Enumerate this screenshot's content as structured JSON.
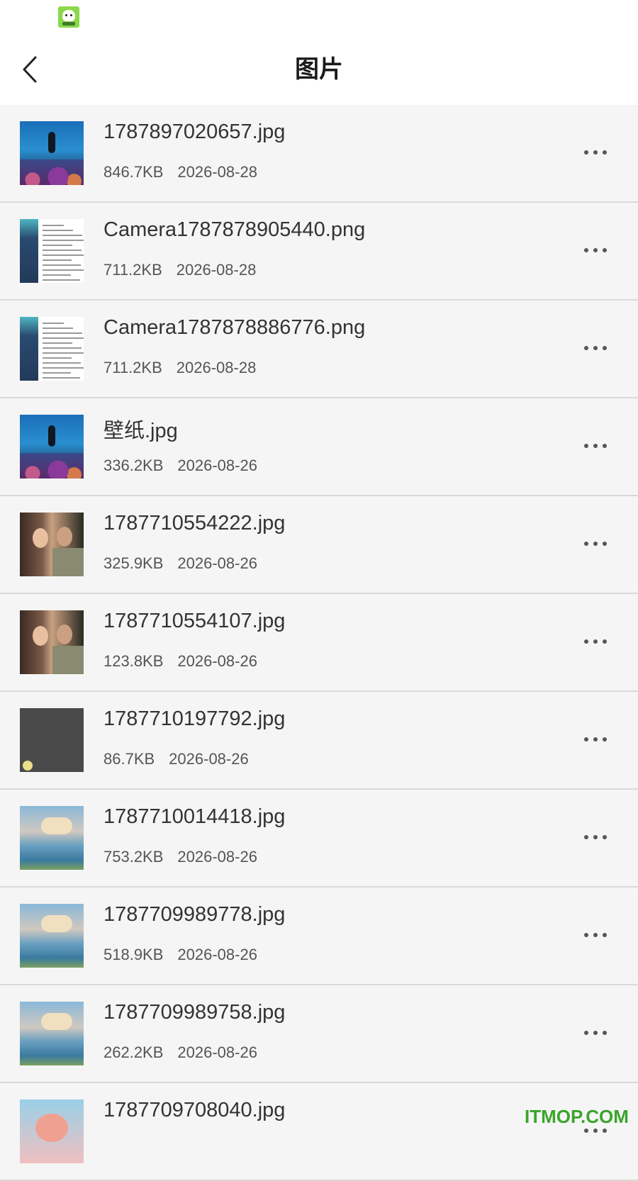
{
  "header": {
    "title": "图片",
    "back_icon": "chevron-left-icon"
  },
  "status_bar": {
    "app_icon": "app-notification-icon"
  },
  "files": [
    {
      "name": "1787897020657.jpg",
      "size": "846.7KB",
      "date": "2026-08-28",
      "thumb": "ocean"
    },
    {
      "name": "Camera1787878905440.png",
      "size": "711.2KB",
      "date": "2026-08-28",
      "thumb": "doc"
    },
    {
      "name": "Camera1787878886776.png",
      "size": "711.2KB",
      "date": "2026-08-28",
      "thumb": "doc"
    },
    {
      "name": "壁纸.jpg",
      "size": "336.2KB",
      "date": "2026-08-26",
      "thumb": "ocean"
    },
    {
      "name": "1787710554222.jpg",
      "size": "325.9KB",
      "date": "2026-08-26",
      "thumb": "photo"
    },
    {
      "name": "1787710554107.jpg",
      "size": "123.8KB",
      "date": "2026-08-26",
      "thumb": "photo"
    },
    {
      "name": "1787710197792.jpg",
      "size": "86.7KB",
      "date": "2026-08-26",
      "thumb": "dark"
    },
    {
      "name": "1787710014418.jpg",
      "size": "753.2KB",
      "date": "2026-08-26",
      "thumb": "sea"
    },
    {
      "name": "1787709989778.jpg",
      "size": "518.9KB",
      "date": "2026-08-26",
      "thumb": "sea"
    },
    {
      "name": "1787709989758.jpg",
      "size": "262.2KB",
      "date": "2026-08-26",
      "thumb": "sea"
    },
    {
      "name": "1787709708040.jpg",
      "size": "",
      "date": "",
      "thumb": "flower"
    }
  ],
  "more_icon": "more-horizontal-icon",
  "watermark": "ITMOP.COM"
}
